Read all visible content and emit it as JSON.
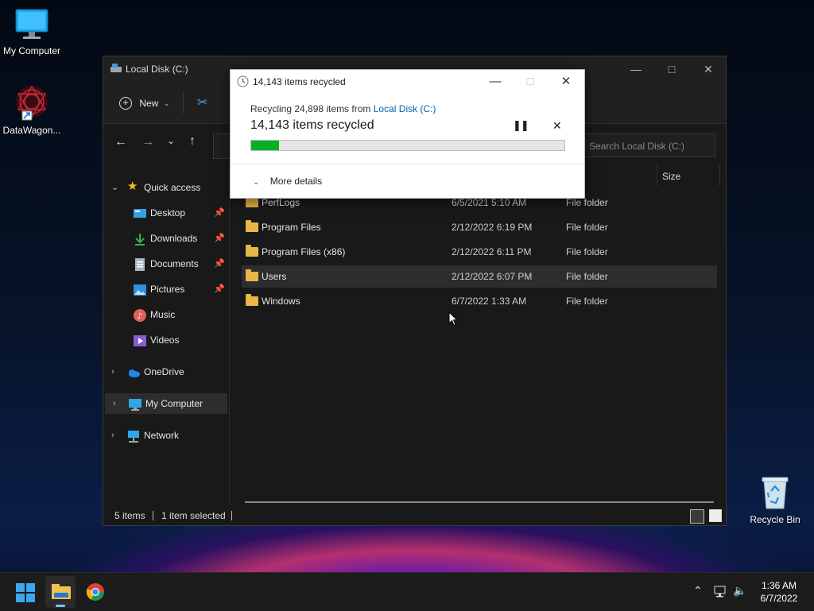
{
  "desktop": {
    "icons": [
      {
        "label": "My Computer"
      },
      {
        "label": "DataWagon..."
      },
      {
        "label": "Recycle Bin"
      }
    ]
  },
  "explorer": {
    "title": "Local Disk (C:)",
    "toolbar": {
      "new_label": "New"
    },
    "search_placeholder": "Search Local Disk (C:)",
    "column_size": "Size",
    "nav": {
      "quick_access": "Quick access",
      "items": [
        {
          "label": "Desktop",
          "icon": "desktop-icon"
        },
        {
          "label": "Downloads",
          "icon": "download-icon"
        },
        {
          "label": "Documents",
          "icon": "document-icon"
        },
        {
          "label": "Pictures",
          "icon": "picture-icon"
        },
        {
          "label": "Music",
          "icon": "music-icon"
        },
        {
          "label": "Videos",
          "icon": "video-icon"
        }
      ],
      "onedrive": "OneDrive",
      "my_computer": "My Computer",
      "network": "Network"
    },
    "files": [
      {
        "name": "PerfLogs",
        "date": "6/5/2021 5:10 AM",
        "type": "File folder"
      },
      {
        "name": "Program Files",
        "date": "2/12/2022 6:19 PM",
        "type": "File folder"
      },
      {
        "name": "Program Files (x86)",
        "date": "2/12/2022 6:11 PM",
        "type": "File folder"
      },
      {
        "name": "Users",
        "date": "2/12/2022 6:07 PM",
        "type": "File folder"
      },
      {
        "name": "Windows",
        "date": "6/7/2022 1:33 AM",
        "type": "File folder"
      }
    ],
    "status": {
      "count": "5 items",
      "selected": "1 item selected"
    }
  },
  "dialog": {
    "title": "14,143 items recycled",
    "line_prefix": "Recycling 24,898 items from",
    "line_link": "Local Disk (C:)",
    "headline": "14,143 items recycled",
    "progress": 0.09,
    "more_details": "More details"
  },
  "taskbar": {
    "time": "1:36 AM",
    "date": "6/7/2022"
  },
  "colors": {
    "progress": "#06b025",
    "link": "#0063b1",
    "accent": "#1e90ff"
  }
}
